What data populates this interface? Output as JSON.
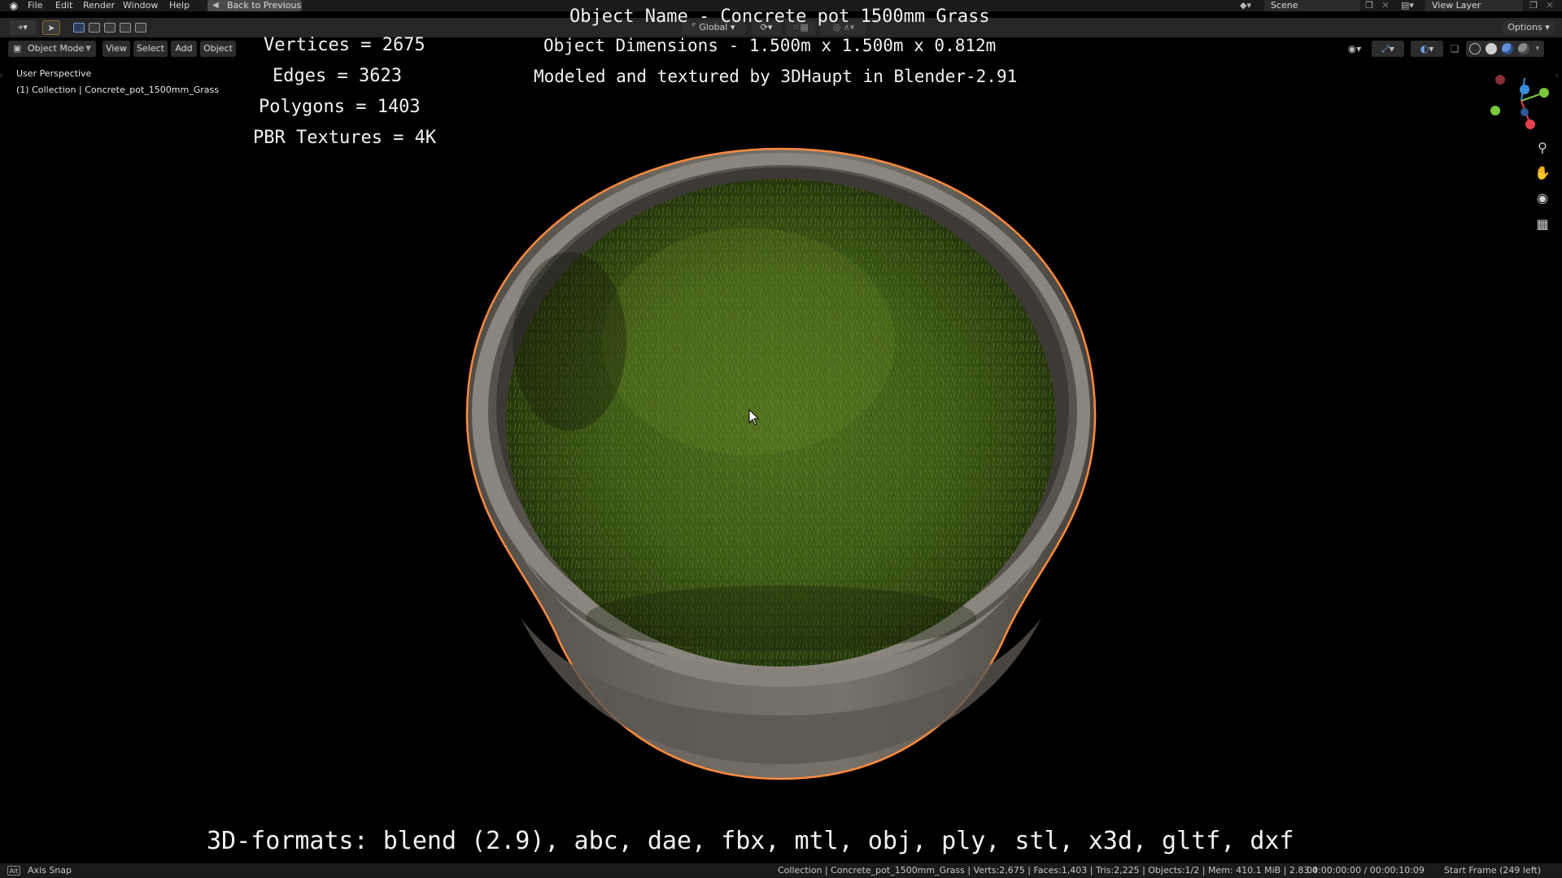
{
  "topbar": {
    "menu": [
      "File",
      "Edit",
      "Render",
      "Window",
      "Help"
    ],
    "back_button": "Back to Previous",
    "scene": "Scene",
    "view_layer": "View Layer"
  },
  "toolheader": {
    "pivot": "Global",
    "options": "Options"
  },
  "viewport_header": {
    "mode": "Object Mode",
    "menus": [
      "View",
      "Select",
      "Add",
      "Object"
    ]
  },
  "viewport": {
    "perspective": "User Perspective",
    "collection_label": "(1) Collection | Concrete_pot_1500mm_Grass",
    "object_name": "Object Name - Concrete pot 1500mm Grass",
    "dimensions": "Object Dimensions -  1.500m x 1.500m x 0.812m",
    "credit": "Modeled and textured by 3DHaupt in Blender-2.91",
    "stats": [
      "Vertices = 2675",
      "Edges = 3623",
      "Polygons = 1403",
      "PBR Textures = 4K"
    ],
    "formats": "3D-formats: blend (2.9), abc, dae, fbx, mtl, obj, ply, stl, x3d, gltf, dxf"
  },
  "statusbar": {
    "key_label": "Alt",
    "snap_label": "Axis Snap",
    "scene_stats": "Collection | Concrete_pot_1500mm_Grass | Verts:2,675 | Faces:1,403 | Tris:2,225 | Objects:1/2 | Mem: 410.1 MiB | 2.83.4",
    "timecode": "00:00:00:00 / 00:00:10:09",
    "frame_info": "Start Frame (249 left)"
  },
  "colors": {
    "selection_outline": "#ff8a3d",
    "grass": "#4a6a1c",
    "concrete": "#6f6b63",
    "axis_x": "#e8414e",
    "axis_y": "#7bc83c",
    "axis_z": "#3d8bdc"
  },
  "icons": [
    "blender-logo-icon",
    "back-arrow-icon",
    "scene-icon",
    "view-layer-icon",
    "editor-type-icon",
    "select-cursor-icon",
    "object-mode-icon",
    "zoom-icon",
    "pan-hand-icon",
    "camera-icon",
    "grid-icon",
    "cursor-icon"
  ]
}
